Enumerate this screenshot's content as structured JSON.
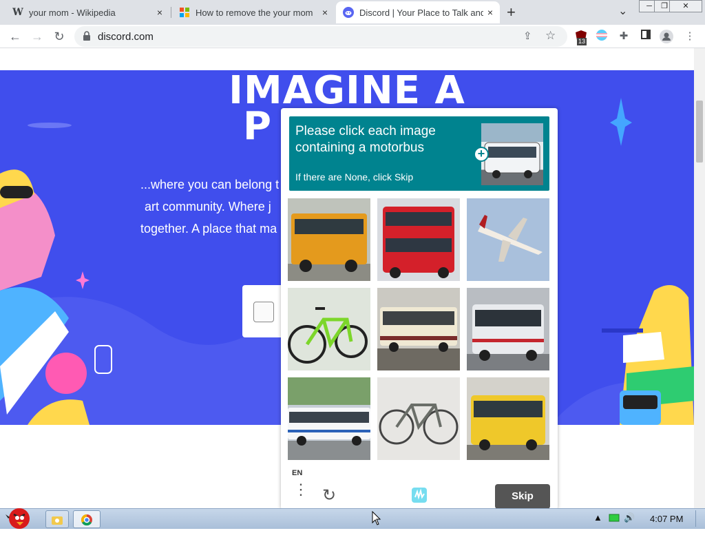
{
  "tabs": [
    {
      "favicon": "W",
      "title": "your mom - Wikipedia",
      "close": "×",
      "active": false
    },
    {
      "favicon": "ms",
      "title": "How to remove the your mom",
      "close": "×",
      "active": false
    },
    {
      "favicon": "discord",
      "title": "Discord | Your Place to Talk and",
      "close": "×",
      "active": true
    }
  ],
  "tab_new": "+",
  "tab_dropdown": "⌄",
  "window_controls": {
    "minimize": "─",
    "restore": "❐",
    "close": "✕"
  },
  "toolbar": {
    "back": "←",
    "forward": "→",
    "reload": "↻",
    "url": "discord.com",
    "ext_badge": "13"
  },
  "hero": {
    "title_line1": "IMAGINE A",
    "title_line2": "P",
    "text_line1": "...where you can belong t",
    "text_line2": "art community. Where j",
    "text_line3": "together. A place that ma"
  },
  "captcha": {
    "prompt": "Please click each image containing a motorbus",
    "subprompt": "If there are None, click Skip",
    "plus": "+",
    "tiles": [
      "school-bus",
      "double-decker-bus",
      "airplane",
      "bicycle",
      "tram-bus",
      "city-bus",
      "articulated-bus",
      "bicycle",
      "yellow-bus"
    ],
    "lang": "EN",
    "menu": "⋮",
    "refresh": "↻",
    "skip": "Skip"
  },
  "taskbar": {
    "time": "4:07 PM"
  },
  "colors": {
    "discord_blurple": "#404eed",
    "captcha_teal": "#00838f",
    "skip_button": "#555555"
  }
}
